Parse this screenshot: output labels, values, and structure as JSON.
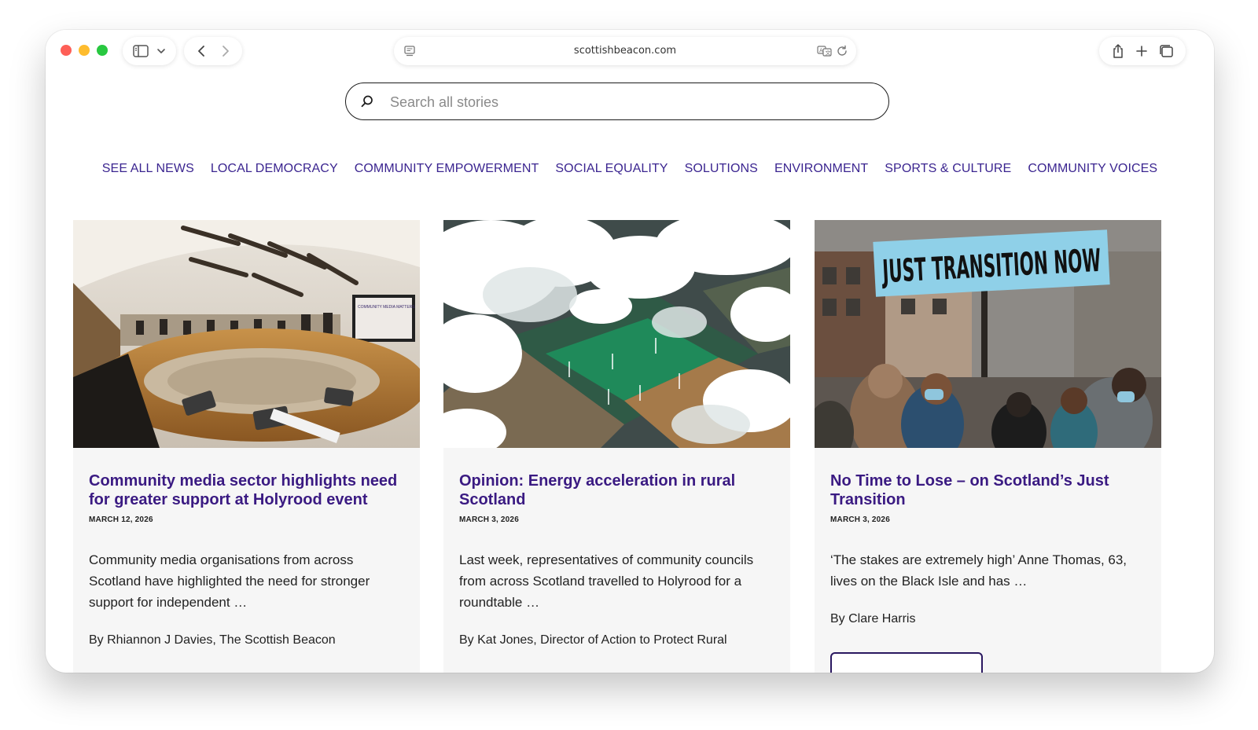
{
  "browser": {
    "url": "scottishbeacon.com"
  },
  "search": {
    "placeholder": "Search all stories"
  },
  "nav": {
    "items": [
      "SEE ALL NEWS",
      "LOCAL DEMOCRACY",
      "COMMUNITY EMPOWERMENT",
      "SOCIAL EQUALITY",
      "SOLUTIONS",
      "ENVIRONMENT",
      "SPORTS & CULTURE",
      "COMMUNITY VOICES"
    ]
  },
  "articles": [
    {
      "title": "Community media sector highlights need for greater support at Holyrood event",
      "date": "MARCH 12, 2026",
      "excerpt": "Community media organisations from across Scotland have highlighted the need for stronger support for independent …",
      "byline": "By Rhiannon J Davies, The Scottish Beacon",
      "image": "photo of a round-table meeting in a chamber",
      "screen_text": "COMMUNITY MEDIA MATTERS"
    },
    {
      "title": "Opinion: Energy acceleration in rural Scotland",
      "date": "MARCH 3, 2026",
      "excerpt": "Last week, representatives of community councils from across Scotland travelled to Holyrood for a roundtable …",
      "byline": "By Kat Jones, Director of Action to Protect Rural",
      "image": "aerial photo of fields with wind turbines under clouds"
    },
    {
      "title": "No Time to Lose – on Scotland’s Just Transition",
      "date": "MARCH 3, 2026",
      "excerpt": "‘The stakes are extremely high’ Anne Thomas, 63, lives on the Black Isle and has …",
      "byline": "By Clare Harris",
      "image": "photo of protesters holding a placard",
      "sign_text": "JUST TRANSITION NOW"
    }
  ],
  "colors": {
    "nav_link": "#3b2590",
    "headline": "#3a1a82",
    "card_bg": "#f6f6f6"
  }
}
